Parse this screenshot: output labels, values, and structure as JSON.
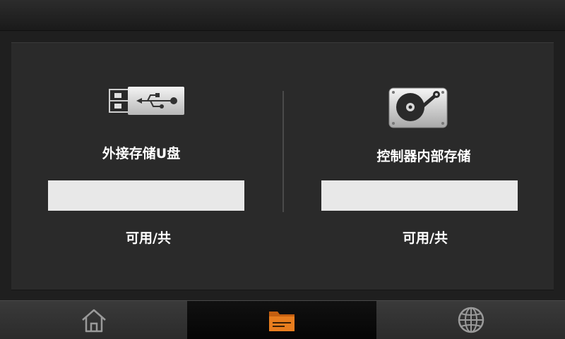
{
  "storage": {
    "usb": {
      "title": "外接存储U盘",
      "caption": "可用/共",
      "used_fraction": 0,
      "icon": "usb-drive-icon"
    },
    "internal": {
      "title": "控制器内部存储",
      "caption": "可用/共",
      "used_fraction": 0,
      "icon": "hard-disk-icon"
    }
  },
  "nav": {
    "tabs": [
      {
        "icon": "home-icon",
        "active": false
      },
      {
        "icon": "folder-icon",
        "active": true
      },
      {
        "icon": "globe-icon",
        "active": false
      }
    ]
  },
  "colors": {
    "background": "#1f1f1f",
    "panel": "#2a2a2a",
    "bar_empty": "#e8e8e8",
    "bar_fill": "#7ab800",
    "active_icon": "#e87d1e",
    "inactive_icon": "#9a9a9a"
  }
}
